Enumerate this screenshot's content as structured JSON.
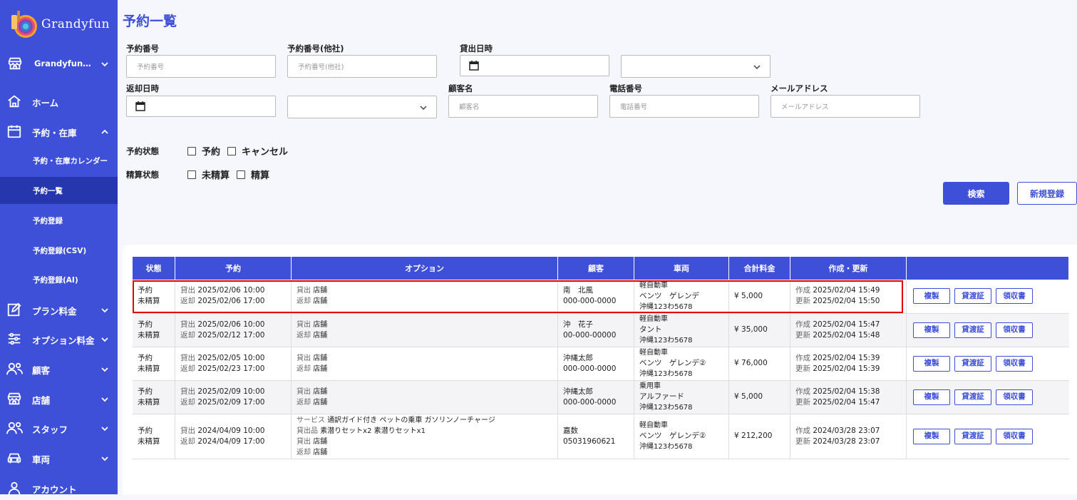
{
  "brand": {
    "name": "Grandyfun"
  },
  "sidebar": {
    "store": "Grandyfun…",
    "items": [
      {
        "label": "ホーム"
      },
      {
        "label": "予約・在庫"
      },
      {
        "label": "プラン料金"
      },
      {
        "label": "オプション料金"
      },
      {
        "label": "顧客"
      },
      {
        "label": "店舗"
      },
      {
        "label": "スタッフ"
      },
      {
        "label": "車両"
      },
      {
        "label": "アカウント"
      }
    ],
    "sub_items": [
      {
        "label": "予約・在庫カレンダー"
      },
      {
        "label": "予約一覧"
      },
      {
        "label": "予約登録"
      },
      {
        "label": "予約登録(CSV)"
      },
      {
        "label": "予約登録(AI)"
      }
    ]
  },
  "page": {
    "title": "予約一覧"
  },
  "filters": {
    "reservation_no": {
      "label": "予約番号",
      "placeholder": "予約番号"
    },
    "reservation_no_other": {
      "label": "予約番号(他社)",
      "placeholder": "予約番号(他社)"
    },
    "rental_datetime": {
      "label": "貸出日時"
    },
    "return_datetime": {
      "label": "返却日時"
    },
    "customer_name": {
      "label": "顧客名",
      "placeholder": "顧客名"
    },
    "phone": {
      "label": "電話番号",
      "placeholder": "電話番号"
    },
    "email": {
      "label": "メールアドレス",
      "placeholder": "メールアドレス"
    },
    "reservation_status": {
      "label": "予約状態",
      "options": [
        "予約",
        "キャンセル"
      ]
    },
    "settlement_status": {
      "label": "精算状態",
      "options": [
        "未精算",
        "精算"
      ]
    },
    "search_label": "検索",
    "new_label": "新規登録"
  },
  "table": {
    "columns": [
      "状態",
      "予約",
      "オプション",
      "顧客",
      "車両",
      "合計料金",
      "作成・更新",
      ""
    ],
    "actions": [
      "複製",
      "貸渡証",
      "領収書"
    ],
    "rows": [
      {
        "status": "予約",
        "settle": "未精算",
        "out_k": "貸出",
        "out": "2025/02/06 10:00",
        "in_k": "返却",
        "in": "2025/02/06 17:00",
        "options": [
          {
            "k": "貸出",
            "v": "店舗"
          },
          {
            "k": "返却",
            "v": "店舗"
          }
        ],
        "customer": "南　北風",
        "tel": "000-000-0000",
        "vehicle": [
          "軽自動車",
          "ベンツ　ゲレンデ",
          "沖縄123わ5678"
        ],
        "total": "¥ 5,000",
        "created": "2025/02/04 15:49",
        "updated": "2025/02/04 15:50"
      },
      {
        "status": "予約",
        "settle": "未精算",
        "out_k": "貸出",
        "out": "2025/02/06 10:00",
        "in_k": "返却",
        "in": "2025/02/12 17:00",
        "options": [
          {
            "k": "貸出",
            "v": "店舗"
          },
          {
            "k": "返却",
            "v": "店舗"
          }
        ],
        "customer": "沖　花子",
        "tel": "00-000-00000",
        "vehicle": [
          "軽自動車",
          "タント",
          "沖縄123わ5678"
        ],
        "total": "¥ 35,000",
        "created": "2025/02/04 15:47",
        "updated": "2025/02/04 15:48"
      },
      {
        "status": "予約",
        "settle": "未精算",
        "out_k": "貸出",
        "out": "2025/02/05 10:00",
        "in_k": "返却",
        "in": "2025/02/23 17:00",
        "options": [
          {
            "k": "貸出",
            "v": "店舗"
          },
          {
            "k": "返却",
            "v": "店舗"
          }
        ],
        "customer": "沖縄太郎",
        "tel": "000-000-0000",
        "vehicle": [
          "軽自動車",
          "ベンツ　ゲレンデ②",
          "沖縄123わ5678"
        ],
        "total": "¥ 76,000",
        "created": "2025/02/04 15:39",
        "updated": "2025/02/04 15:39"
      },
      {
        "status": "予約",
        "settle": "未精算",
        "out_k": "貸出",
        "out": "2025/02/09 10:00",
        "in_k": "返却",
        "in": "2025/02/09 17:00",
        "options": [
          {
            "k": "貸出",
            "v": "店舗"
          },
          {
            "k": "返却",
            "v": "店舗"
          }
        ],
        "customer": "沖縄太郎",
        "tel": "000-000-0000",
        "vehicle": [
          "乗用車",
          "アルファード",
          "沖縄123わ5678"
        ],
        "total": "¥ 5,000",
        "created": "2025/02/04 15:38",
        "updated": "2025/02/04 15:47"
      },
      {
        "status": "予約",
        "settle": "未精算",
        "out_k": "貸出",
        "out": "2024/04/09 10:00",
        "in_k": "返却",
        "in": "2024/04/09 17:00",
        "options": [
          {
            "k": "サービス",
            "v": "通訳ガイド付き ペットの乗車 ガソリンノーチャージ"
          },
          {
            "k": "貸出品",
            "v": "素潜りセットx2 素潜りセットx1"
          },
          {
            "k": "貸出",
            "v": "店舗"
          },
          {
            "k": "返却",
            "v": "店舗"
          }
        ],
        "customer": "嘉数",
        "tel": "05031960621",
        "vehicle": [
          "軽自動車",
          "ベンツ　ゲレンデ②",
          "沖縄123わ5678"
        ],
        "total": "¥ 212,200",
        "created": "2024/03/28 23:07",
        "updated": "2024/03/28 23:07"
      }
    ],
    "created_label": "作成",
    "updated_label": "更新"
  }
}
